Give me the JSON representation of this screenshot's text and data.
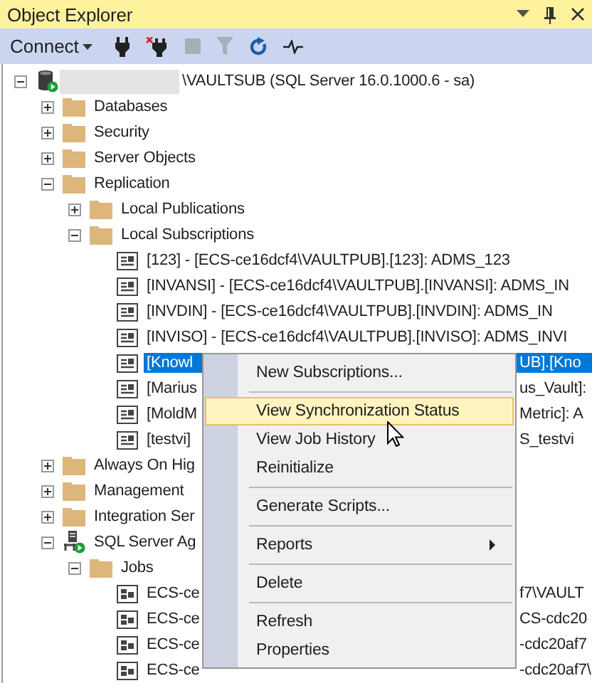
{
  "panel": {
    "title": "Object Explorer"
  },
  "toolbar": {
    "connect_label": "Connect"
  },
  "tree": [
    {
      "kind": "server",
      "redacted": true,
      "label": "\\VAULTSUB (SQL Server 16.0.1000.6 - sa)",
      "expanded": true,
      "selected": false,
      "children": [
        {
          "kind": "folder",
          "label": "Databases",
          "expanded": false,
          "selected": false
        },
        {
          "kind": "folder",
          "label": "Security",
          "expanded": false,
          "selected": false
        },
        {
          "kind": "folder",
          "label": "Server Objects",
          "expanded": false,
          "selected": false
        },
        {
          "kind": "folder",
          "label": "Replication",
          "expanded": true,
          "selected": false,
          "children": [
            {
              "kind": "folder",
              "label": "Local Publications",
              "expanded": false,
              "selected": false
            },
            {
              "kind": "folder",
              "label": "Local Subscriptions",
              "expanded": true,
              "selected": false,
              "children": [
                {
                  "kind": "subscription",
                  "label": "[123] - [ECS-ce16dcf4\\VAULTPUB].[123]: ADMS_123",
                  "selected": false
                },
                {
                  "kind": "subscription",
                  "label": "[INVANSI] - [ECS-ce16dcf4\\VAULTPUB].[INVANSI]: ADMS_IN",
                  "selected": false
                },
                {
                  "kind": "subscription",
                  "label": "[INVDIN] - [ECS-ce16dcf4\\VAULTPUB].[INVDIN]: ADMS_IN",
                  "selected": false
                },
                {
                  "kind": "subscription",
                  "label": "[INVISO] - [ECS-ce16dcf4\\VAULTPUB].[INVISO]: ADMS_INVI",
                  "selected": false
                },
                {
                  "kind": "subscription",
                  "label": "[Knowl",
                  "label_after_menu": "UB].[Kno",
                  "selected": true
                },
                {
                  "kind": "subscription",
                  "label": "[Marius",
                  "label_after_menu": "us_Vault]:",
                  "selected": false
                },
                {
                  "kind": "subscription",
                  "label": "[MoldM",
                  "label_after_menu": "Metric]: A",
                  "selected": false
                },
                {
                  "kind": "subscription",
                  "label": "[testvi]",
                  "label_after_menu": "S_testvi",
                  "selected": false
                }
              ]
            }
          ]
        },
        {
          "kind": "folder",
          "label": "Always On Hig",
          "expanded": false,
          "selected": false
        },
        {
          "kind": "folder",
          "label": "Management",
          "expanded": false,
          "selected": false
        },
        {
          "kind": "folder",
          "label": "Integration Ser",
          "expanded": false,
          "selected": false
        },
        {
          "kind": "agent",
          "label": "SQL Server Ag",
          "expanded": true,
          "selected": false,
          "children": [
            {
              "kind": "folder",
              "label": "Jobs",
              "expanded": true,
              "selected": false,
              "children": [
                {
                  "kind": "job",
                  "label": "ECS-ce",
                  "label_after_menu": "f7\\VAULT",
                  "selected": false
                },
                {
                  "kind": "job",
                  "label": "ECS-ce",
                  "label_after_menu": "CS-cdc20",
                  "selected": false
                },
                {
                  "kind": "job",
                  "label": "ECS-ce",
                  "label_after_menu": "-cdc20af7",
                  "selected": false
                },
                {
                  "kind": "job",
                  "label": "ECS-ce",
                  "label_after_menu": "-cdc20af7\\",
                  "selected": false
                }
              ]
            }
          ]
        }
      ]
    }
  ],
  "context_menu": [
    {
      "kind": "item",
      "label": "New Subscriptions...",
      "selected": false
    },
    {
      "kind": "separator"
    },
    {
      "kind": "item",
      "label": "View Synchronization Status",
      "selected": true
    },
    {
      "kind": "item",
      "label": "View Job History",
      "selected": false
    },
    {
      "kind": "item",
      "label": "Reinitialize",
      "selected": false
    },
    {
      "kind": "separator"
    },
    {
      "kind": "item",
      "label": "Generate Scripts...",
      "selected": false
    },
    {
      "kind": "separator"
    },
    {
      "kind": "item",
      "label": "Reports",
      "selected": false,
      "submenu": true
    },
    {
      "kind": "separator"
    },
    {
      "kind": "item",
      "label": "Delete",
      "selected": false
    },
    {
      "kind": "separator"
    },
    {
      "kind": "item",
      "label": "Refresh",
      "selected": false
    },
    {
      "kind": "item",
      "label": "Properties",
      "selected": false
    }
  ]
}
